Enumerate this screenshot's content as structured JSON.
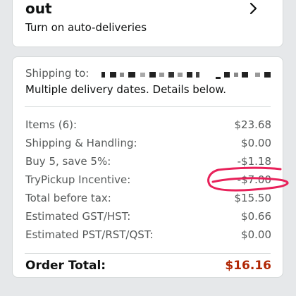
{
  "autodelivery": {
    "title": "out",
    "subtitle": "Turn on auto-deliveries"
  },
  "shipping": {
    "label": "Shipping to:",
    "details": "Multiple delivery dates. Details below."
  },
  "summary": {
    "rows": [
      {
        "label": "Items (6):",
        "value": "$23.68"
      },
      {
        "label": "Shipping & Handling:",
        "value": "$0.00"
      },
      {
        "label": "Buy 5, save 5%:",
        "value": "-$1.18"
      },
      {
        "label": "TryPickup Incentive:",
        "value": "-$7.00"
      },
      {
        "label": "Total before tax:",
        "value": "$15.50"
      },
      {
        "label": "Estimated GST/HST:",
        "value": "$0.66"
      },
      {
        "label": "Estimated PST/RST/QST:",
        "value": "$0.00"
      }
    ],
    "order_total_label": "Order Total:",
    "order_total_value": "$16.16"
  },
  "colors": {
    "order_total": "#b12704",
    "annotation": "#e8215a",
    "background": "#e6e8ea"
  },
  "icons": {
    "top_card": "chevron-right-icon"
  }
}
